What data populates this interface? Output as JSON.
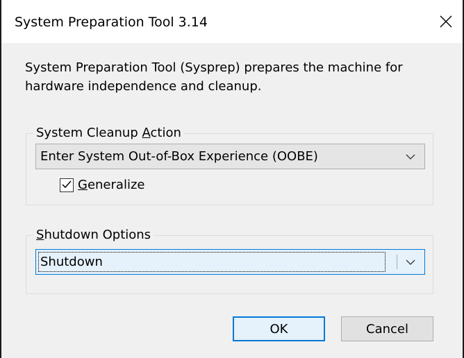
{
  "window": {
    "title": "System Preparation Tool 3.14"
  },
  "description": "System Preparation Tool (Sysprep) prepares the machine for hardware independence and cleanup.",
  "cleanup": {
    "label_prefix": "System Cleanup ",
    "label_access_key": "A",
    "label_suffix": "ction",
    "selected": "Enter System Out-of-Box Experience (OOBE)",
    "generalize_access_key": "G",
    "generalize_rest": "eneralize",
    "generalize_checked": true
  },
  "shutdown": {
    "label_access_key": "S",
    "label_suffix": "hutdown Options",
    "selected": "Shutdown"
  },
  "buttons": {
    "ok": "OK",
    "cancel": "Cancel"
  },
  "icons": {
    "close": "close-icon",
    "dropdown": "chevron-down-icon",
    "check": "checkmark-icon"
  }
}
